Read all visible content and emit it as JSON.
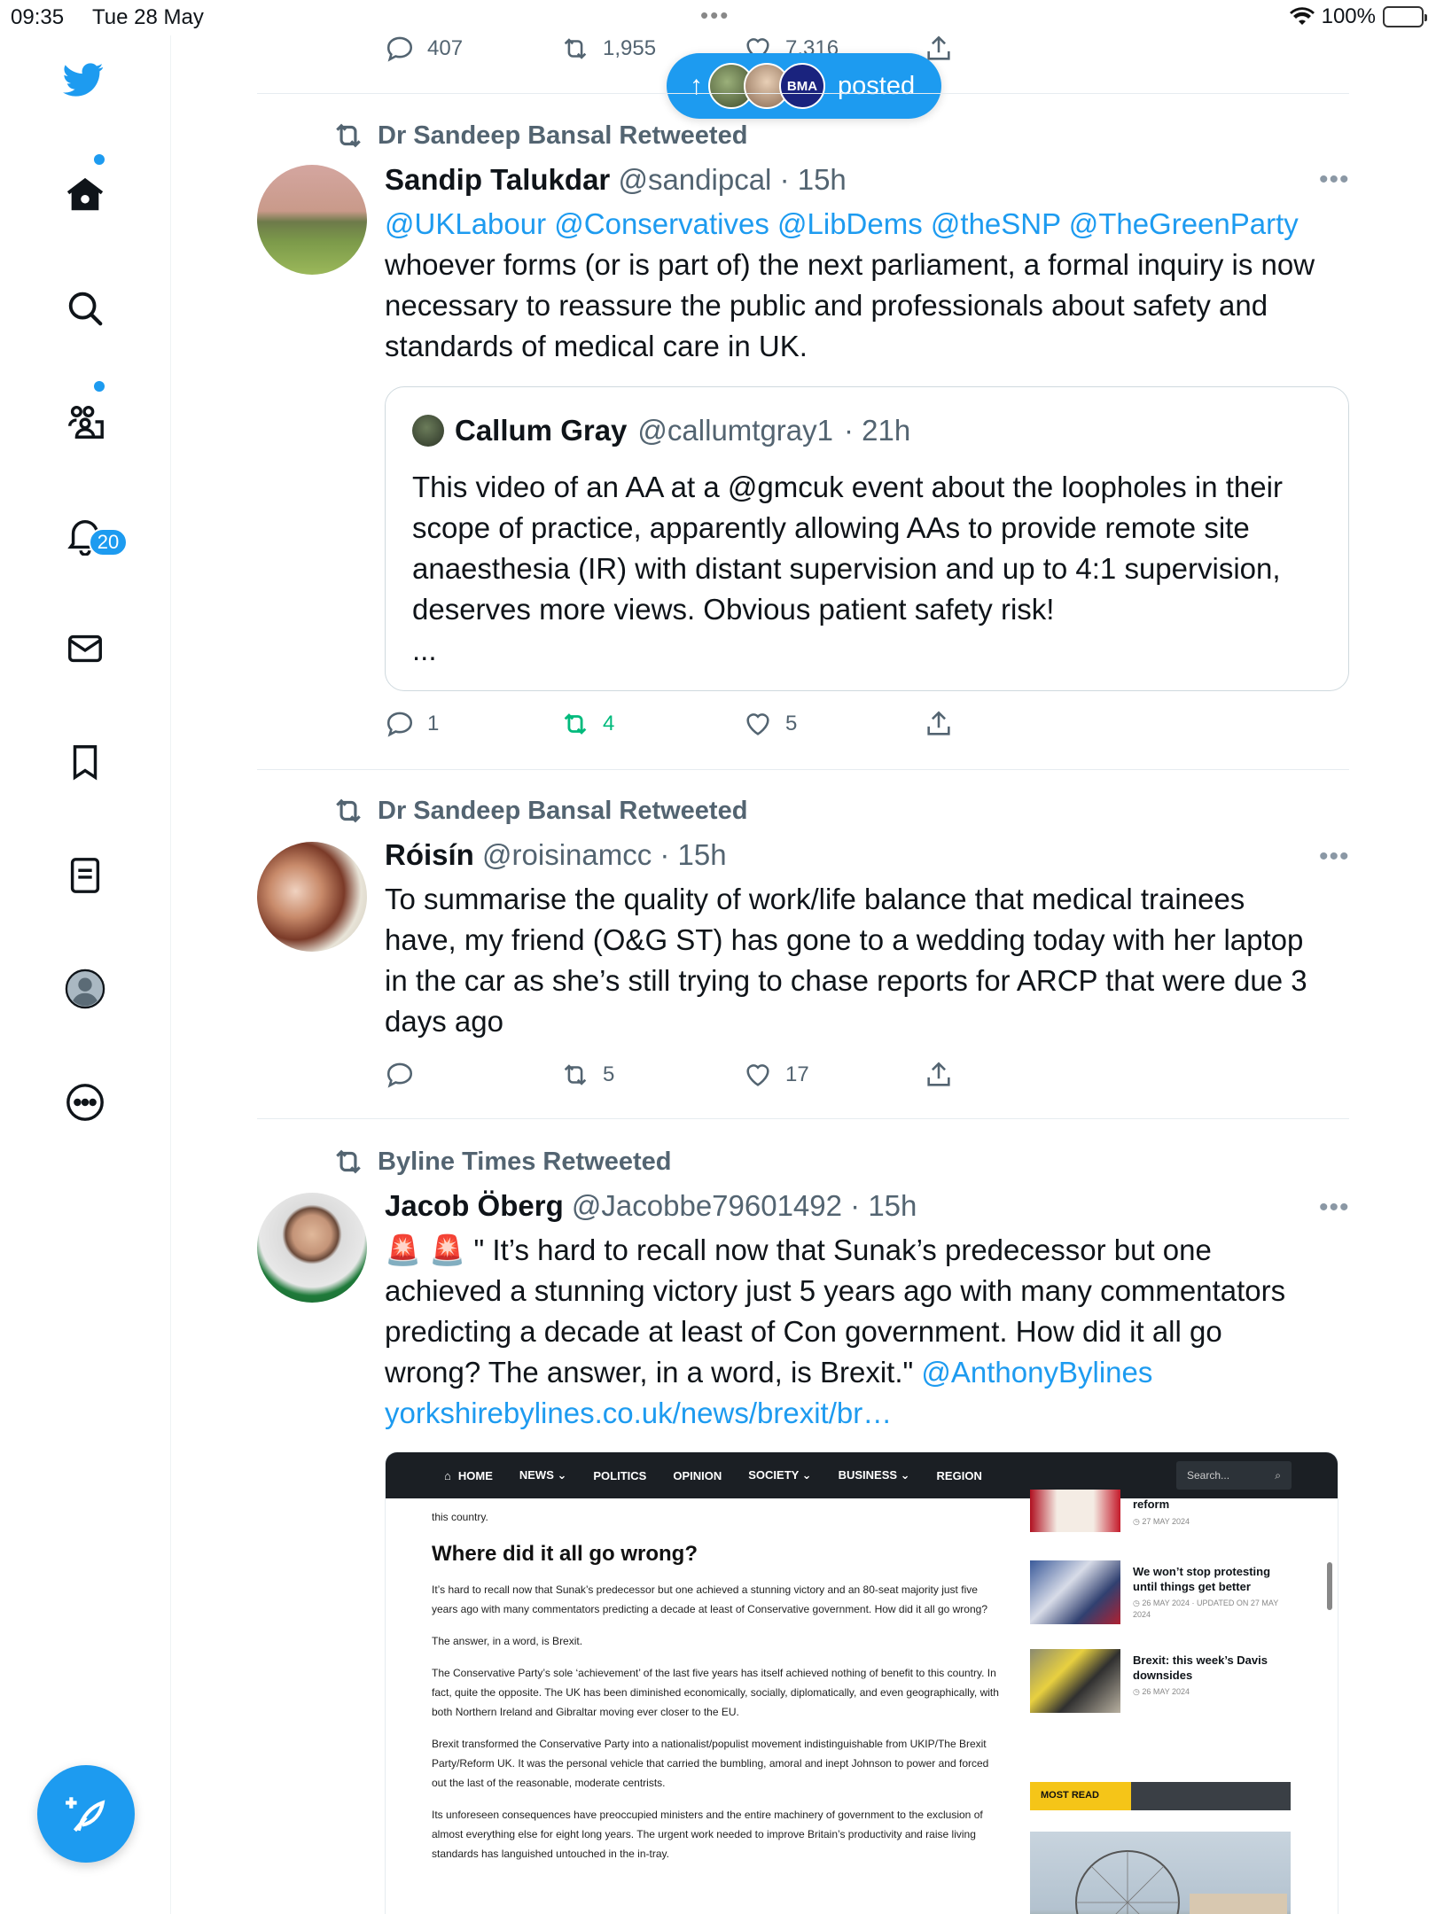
{
  "status_bar": {
    "time": "09:35",
    "date": "Tue 28 May",
    "battery": "100%"
  },
  "toast": {
    "label": "posted",
    "avatar_badge": "BMA"
  },
  "top_actions": {
    "replies": "407",
    "retweets": "1,955",
    "likes": "7,316"
  },
  "sidebar": {
    "notifications_count": "20"
  },
  "tweets": [
    {
      "retweeted_by": "Dr Sandeep Bansal Retweeted",
      "name": "Sandip Talukdar",
      "handle": "@sandipcal",
      "time": "· 15h",
      "mentions": "@UKLabour @Conservatives @LibDems @theSNP @TheGreenParty",
      "text": "whoever forms (or is part of) the next parliament, a formal inquiry is now necessary to reassure the public and professionals about safety and standards of medical care in UK.",
      "quote": {
        "name": "Callum Gray",
        "handle": "@callumtgray1",
        "time": "· 21h",
        "text": "This video of an AA at a @gmcuk event about the loopholes in their scope of practice, apparently allowing AAs to provide remote site anaesthesia (IR) with distant supervision and up to 4:1 supervision, deserves more views.  Obvious patient safety risk!",
        "ellipsis": "..."
      },
      "replies": "1",
      "retweets": "4",
      "likes": "5"
    },
    {
      "retweeted_by": "Dr Sandeep Bansal Retweeted",
      "name": "Róisín",
      "handle": "@roisinamcc",
      "time": "· 15h",
      "text": "To summarise the quality of work/life balance that medical trainees have, my friend (O&G ST) has gone to a wedding today with her laptop in the car as she’s still trying to chase reports for ARCP that were due 3 days ago",
      "replies": "",
      "retweets": "5",
      "likes": "17"
    },
    {
      "retweeted_by": "Byline Times Retweeted",
      "name": "Jacob Öberg",
      "handle": "@Jacobbe79601492",
      "time": "· 15h",
      "emoji": "🚨 🚨",
      "text": " \" It’s hard to recall now that Sunak’s predecessor but one achieved a stunning victory just 5 years ago with many commentators predicting a decade at least of Con government. How did it all go wrong? The answer, in a word, is Brexit.\" ",
      "mention": "@AnthonyBylines",
      "link": "yorkshirebylines.co.uk/news/brexit/br…"
    }
  ],
  "web": {
    "nav": [
      "HOME",
      "NEWS ⌄",
      "POLITICS",
      "OPINION",
      "SOCIETY ⌄",
      "BUSINESS ⌄",
      "REGION"
    ],
    "search": "Search...",
    "intro": "this country.",
    "heading": "Where did it all go wrong?",
    "paragraphs": [
      "It’s hard to recall now that Sunak’s predecessor but one achieved a stunning victory and an 80-seat majority just five years ago with many commentators predicting a decade at least of Conservative government. How did it all go wrong?",
      "The answer, in a word, is Brexit.",
      "The Conservative Party’s sole ‘achievement’ of the last five years has itself achieved nothing of benefit to this country. In fact, quite the opposite. The UK has been diminished economically, socially, diplomatically, and even geographically, with both Northern Ireland and Gibraltar moving ever closer to the EU.",
      "Brexit transformed the Conservative Party into a nationalist/populist movement indistinguishable from UKIP/The Brexit Party/Reform UK. It was the personal vehicle that carried the bumbling, amoral and inept Johnson to power and forced out the last of the reasonable, moderate centrists.",
      "Its unforeseen consequences have preoccupied ministers and the entire machinery of government to the exclusion of almost everything else for eight long years. The urgent work needed to improve Britain’s productivity and raise living standards has languished untouched in the in-tray."
    ],
    "side_items": [
      {
        "title": "reform",
        "date": "◷ 27 MAY 2024"
      },
      {
        "title": "We won’t stop protesting until things get better",
        "date": "◷ 26 MAY 2024 · UPDATED ON 27 MAY 2024"
      },
      {
        "title": "Brexit: this week’s Davis downsides",
        "date": "◷ 26 MAY 2024"
      }
    ],
    "most_read": "MOST READ"
  }
}
